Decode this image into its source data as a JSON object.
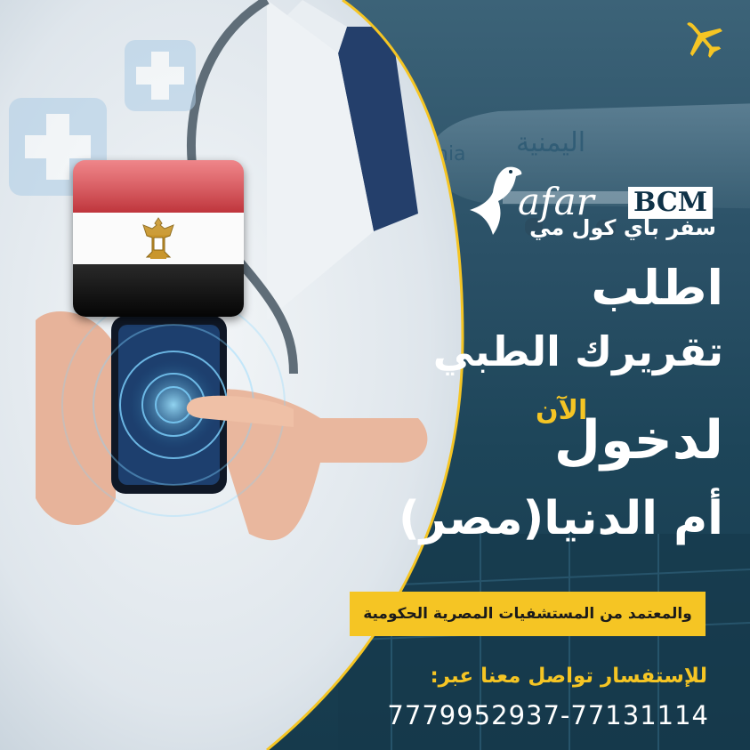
{
  "brand": {
    "logo_word": "afar",
    "logo_bcm": "BCM",
    "tagline": "سفر باي كول مي"
  },
  "headline": {
    "line1": "اطلب",
    "line2": "تقريرك الطبي",
    "line3": "لدخول",
    "now": "الآن",
    "line4": "أم الدنيا(مصر)"
  },
  "banner": {
    "text": "والمعتمد من المستشفيات المصرية الحكومية"
  },
  "contact": {
    "inquiry": "للإستفسار تواصل معنا عبر:",
    "phones": "7779952937-77131114"
  },
  "background_text": {
    "plane_arabic": "اليمنية",
    "plane_latin": "nia"
  },
  "icons": {
    "top_right": "airplane-icon",
    "logo_mark": "bird-icon",
    "flag": "egypt-flag-icon"
  },
  "colors": {
    "accent_yellow": "#f5c524",
    "background_navy": "#0f3247",
    "text_white": "#ffffff"
  }
}
